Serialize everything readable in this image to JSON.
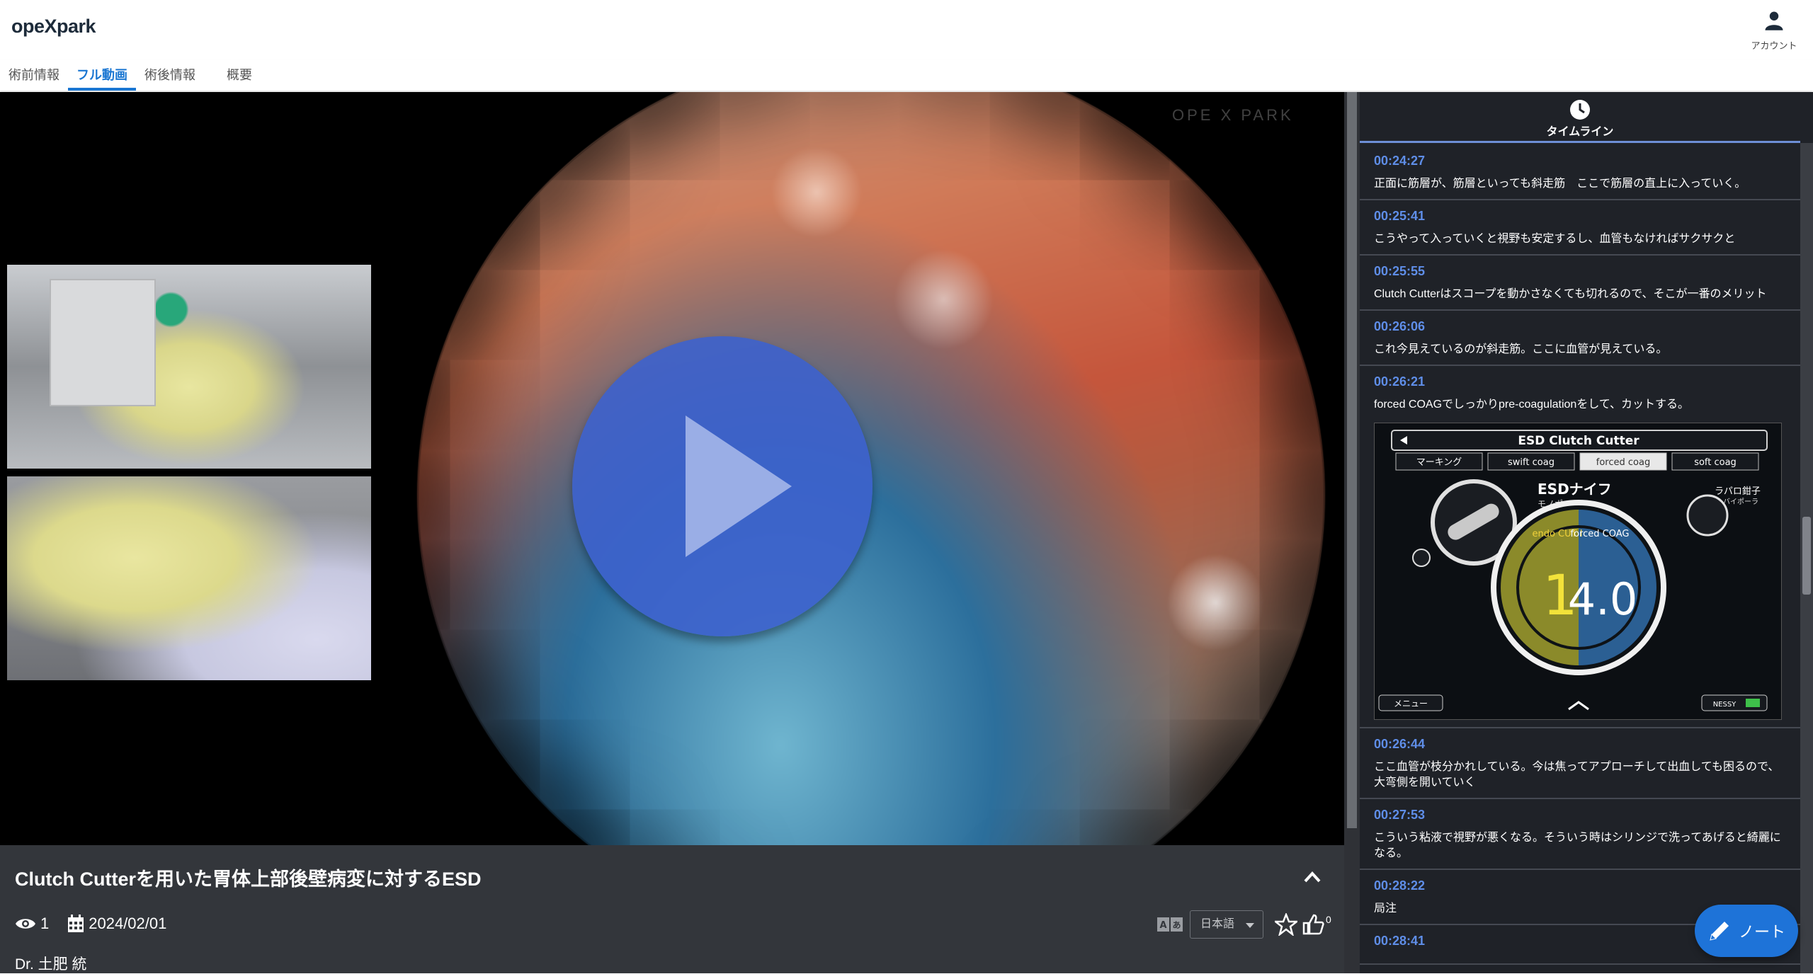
{
  "header": {
    "logo": "opeXpark",
    "account_label": "アカウント"
  },
  "tabs": [
    {
      "label": "術前情報",
      "active": false
    },
    {
      "label": "フル動画",
      "active": true
    },
    {
      "label": "術後情報",
      "active": false
    },
    {
      "label": "概要",
      "active": false
    }
  ],
  "video": {
    "play_icon": "play-icon",
    "watermark": "OPE X PARK"
  },
  "info": {
    "title": "Clutch Cutterを用いた胃体上部後壁病変に対するESD",
    "views": "1",
    "date": "2024/02/01",
    "doctor": "Dr. 土肥 統",
    "language": "日本語",
    "likes": "0"
  },
  "timeline": {
    "title": "タイムライン",
    "entries": [
      {
        "time": "00:24:27",
        "text": "正面に筋層が、筋層といっても斜走筋　ここで筋層の直上に入っていく。"
      },
      {
        "time": "00:25:41",
        "text": "こうやって入っていくと視野も安定するし、血管もなければサクサクと"
      },
      {
        "time": "00:25:55",
        "text": "Clutch Cutterはスコープを動かさなくても切れるので、そこが一番のメリット"
      },
      {
        "time": "00:26:06",
        "text": "これ今見えているのが斜走筋。ここに血管が見えている。"
      },
      {
        "time": "00:26:21",
        "text": "forced COAGでしっかりpre-coagulationをして、カットする。"
      },
      {
        "time": "00:26:44",
        "text": "ここ血管が枝分かれしている。今は焦ってアプローチして出血しても困るので、大弯側を開いていく"
      },
      {
        "time": "00:27:53",
        "text": "こういう粘液で視野が悪くなる。そういう時はシリンジで洗ってあげると綺麗になる。"
      },
      {
        "time": "00:28:22",
        "text": "局注"
      },
      {
        "time": "00:28:41",
        "text": ""
      }
    ],
    "generator_ui": {
      "device": "ESD Clutch Cutter",
      "modes": [
        "マーキング",
        "swift coag",
        "forced coag",
        "soft coag"
      ],
      "knife_label": "ESDナイフ",
      "knife_sub": "モノポーラ",
      "forceps_label": "ラパロ鉗子",
      "forceps_sub": "バイポーラ",
      "cut_label": "endo CUT I",
      "coag_label": "forced COAG",
      "cut_value": "1",
      "coag_value": "4.0",
      "menu_label": "メニュー",
      "nessy_label": "NESSY"
    }
  },
  "note_button": {
    "label": "ノート"
  },
  "colors": {
    "accent": "#1a76d2",
    "timestamp": "#5f8ee8",
    "play": "#3d62cd",
    "panel": "#33363b",
    "sidebar": "#1f2228"
  }
}
